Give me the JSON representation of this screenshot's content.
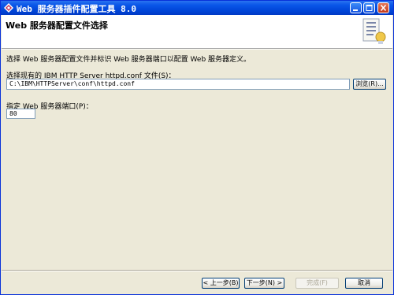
{
  "window": {
    "title": "Web 服务器插件配置工具 8.0",
    "controls": {
      "minimize": "_",
      "maximize": "□",
      "close": "×"
    }
  },
  "header": {
    "title": "Web 服务器配置文件选择",
    "icon": "document-list-icon"
  },
  "main": {
    "description": "选择 Web 服务器配置文件并标识 Web 服务器端口以配置 Web 服务器定义。",
    "config_file": {
      "label": "选择现有的 IBM HTTP Server httpd.conf 文件(S)：",
      "value": "C:\\IBM\\HTTPServer\\conf\\httpd.conf",
      "browse_label": "浏览(R)..."
    },
    "port": {
      "label": "指定 Web 服务器端口(P)：",
      "value": "80"
    }
  },
  "footer": {
    "back_label": "< 上一步(B)",
    "next_label": "下一步(N) >",
    "finish_label": "完成(F)",
    "cancel_label": "取消"
  },
  "colors": {
    "titlebar": "#0A56E8",
    "dialog_bg": "#ECE9D8",
    "input_border": "#7F9DB9"
  }
}
